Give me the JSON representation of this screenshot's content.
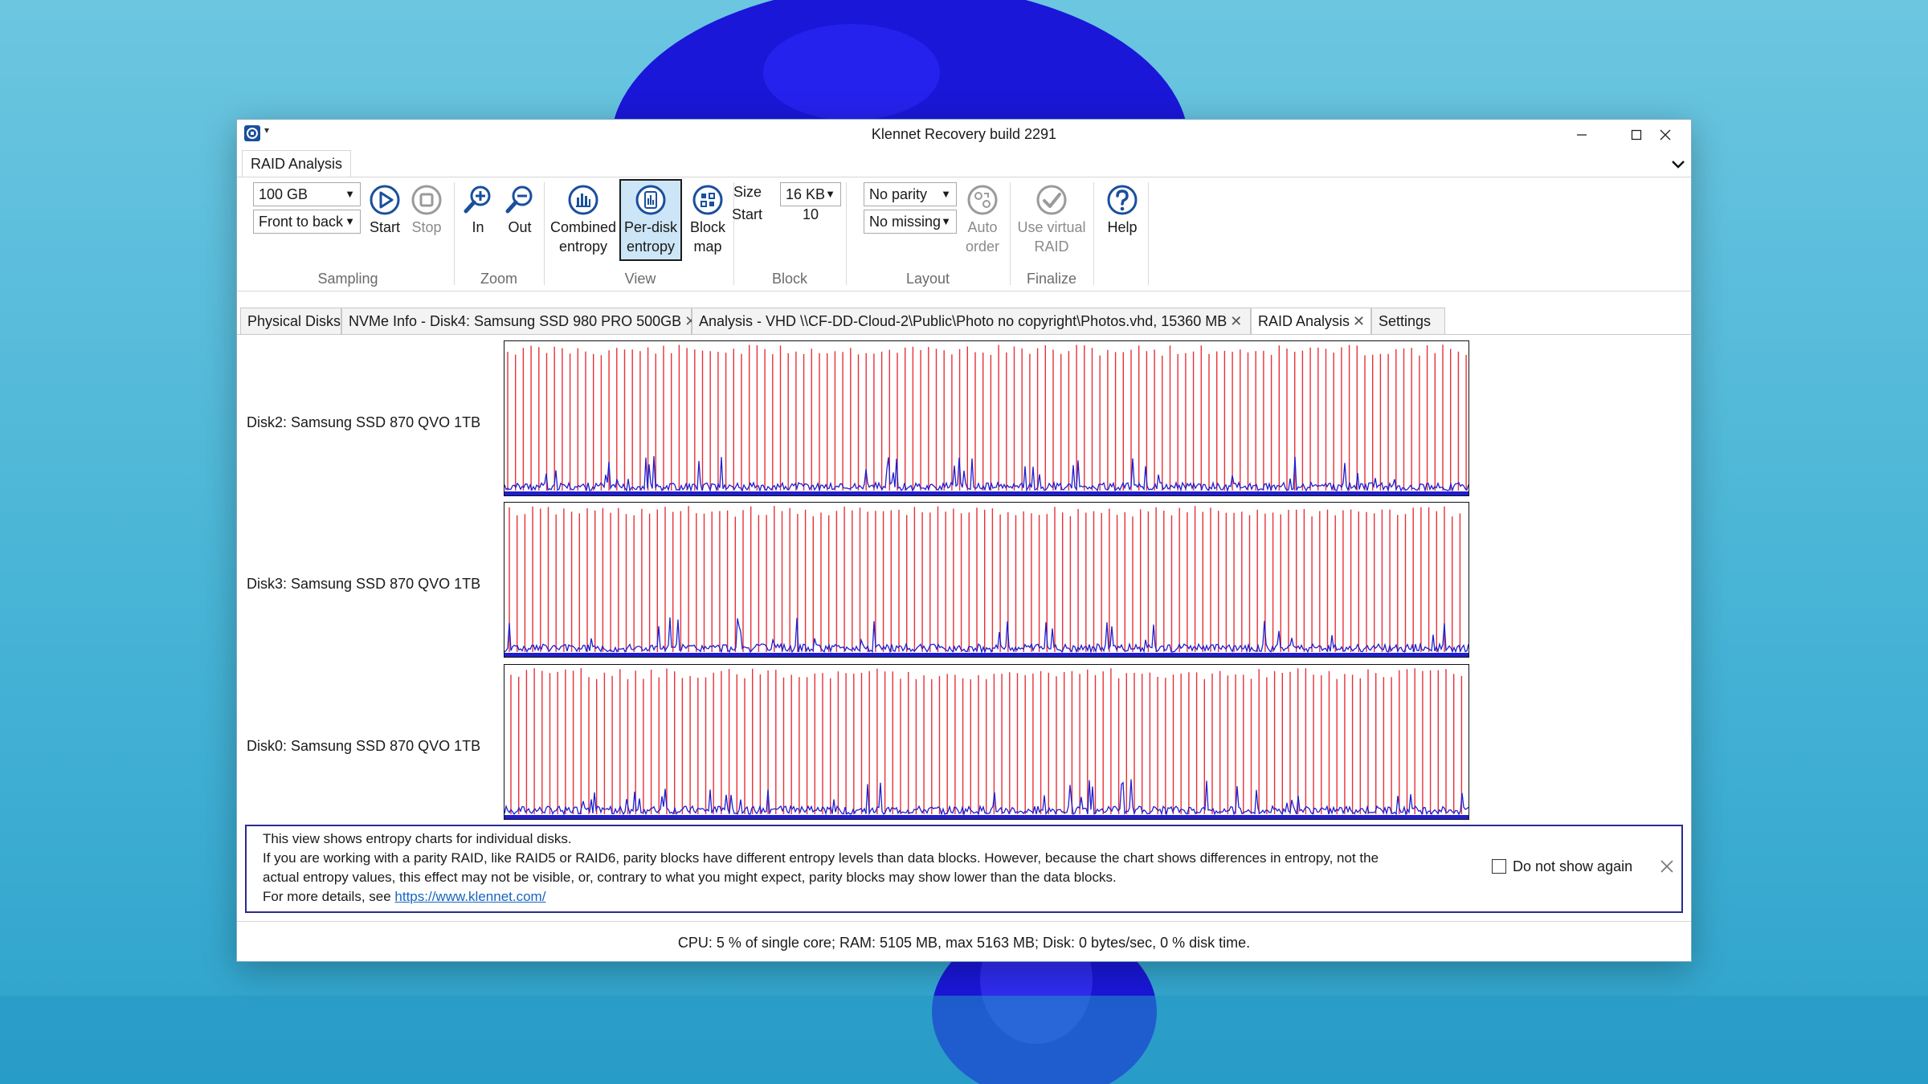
{
  "window": {
    "title": "Klennet Recovery build 2291"
  },
  "ribbon": {
    "tab_label": "RAID Analysis",
    "sampling": {
      "group_label": "Sampling",
      "size_value": "100 GB",
      "order_value": "Front to back",
      "start_label": "Start",
      "stop_label": "Stop"
    },
    "zoom": {
      "group_label": "Zoom",
      "in_label": "In",
      "out_label": "Out"
    },
    "view": {
      "group_label": "View",
      "combined_label_1": "Combined",
      "combined_label_2": "entropy",
      "perdisk_label_1": "Per-disk",
      "perdisk_label_2": "entropy",
      "blockmap_label_1": "Block",
      "blockmap_label_2": "map"
    },
    "block": {
      "group_label": "Block",
      "size_label": "Size",
      "size_value": "16 KB",
      "start_label": "Start",
      "start_value": "10"
    },
    "layout": {
      "group_label": "Layout",
      "parity_value": "No parity",
      "missing_value": "No missing",
      "auto_label_1": "Auto",
      "auto_label_2": "order"
    },
    "finalize": {
      "group_label": "Finalize",
      "virtual_label_1": "Use virtual",
      "virtual_label_2": "RAID"
    },
    "help_label": "Help"
  },
  "tabs": [
    {
      "label": "Physical Disks",
      "closable": false
    },
    {
      "label": "NVMe Info - Disk4:  Samsung SSD 980 PRO 500GB",
      "closable": true
    },
    {
      "label": "Analysis - VHD \\\\CF-DD-Cloud-2\\Public\\Photo no copyright\\Photos.vhd, 15360 MB",
      "closable": true
    },
    {
      "label": "RAID Analysis",
      "closable": true,
      "active": true
    },
    {
      "label": "Settings",
      "closable": false
    }
  ],
  "disks": [
    {
      "label": "Disk2:  Samsung SSD 870 QVO 1TB"
    },
    {
      "label": "Disk3:  Samsung SSD 870 QVO 1TB"
    },
    {
      "label": "Disk0:  Samsung SSD 870 QVO 1TB"
    }
  ],
  "colors": {
    "spike": "#e8313a",
    "baseline": "#1f1fd0",
    "accent": "#1a4f9c"
  },
  "info": {
    "line1": "This view shows entropy charts for individual disks.",
    "line2": "If you are working with a parity RAID, like RAID5 or RAID6, parity blocks have different entropy levels than data blocks. However, because the chart shows differences in entropy, not the",
    "line3": "actual entropy values, this effect may not be visible, or, contrary to what you might expect, parity blocks may show lower than the data blocks.",
    "line4_prefix": "For more details, see ",
    "link": "https://www.klennet.com/",
    "dont_show_label": "Do not show again"
  },
  "status": "CPU: 5 % of single core; RAM: 5105 MB, max 5163 MB; Disk: 0 bytes/sec, 0 % disk time."
}
